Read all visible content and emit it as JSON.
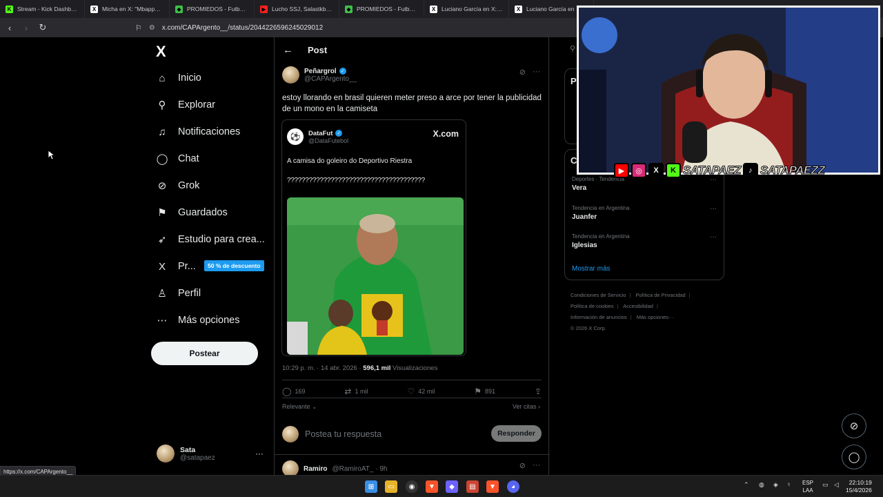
{
  "browser": {
    "tabs": [
      {
        "label": "Stream - Kick Dashboard",
        "color": "#53fc18",
        "glyph": "K"
      },
      {
        "label": "Micha en X: \"Mbappe co",
        "color": "#ffffff",
        "glyph": "X"
      },
      {
        "label": "PROMIEDOS - Futbol Arg",
        "color": "#3fbf4a",
        "glyph": "◆"
      },
      {
        "label": "Lucho SSJ, Salastkbron -",
        "color": "#ff2020",
        "glyph": "▶"
      },
      {
        "label": "PROMIEDOS - Futbol Arg",
        "color": "#3fbf4a",
        "glyph": "◆"
      },
      {
        "label": "Luciano García en X: \"Se x",
        "color": "#ffffff",
        "glyph": "X"
      },
      {
        "label": "Luciano García en",
        "color": "#ffffff",
        "glyph": "X"
      }
    ],
    "url": "x.com/CAPArgento__/status/2044226596245029012",
    "status_url": "https://x.com/CAPArgento__"
  },
  "nav": {
    "logo": "X",
    "items": [
      {
        "label": "Inicio",
        "icon": "home-icon",
        "glyph": "⌂"
      },
      {
        "label": "Explorar",
        "icon": "search-icon",
        "glyph": "⚲"
      },
      {
        "label": "Notificaciones",
        "icon": "bell-icon",
        "glyph": "♫"
      },
      {
        "label": "Chat",
        "icon": "chat-icon",
        "glyph": "◯"
      },
      {
        "label": "Grok",
        "icon": "grok-icon",
        "glyph": "⊘"
      },
      {
        "label": "Guardados",
        "icon": "bookmark-icon",
        "glyph": "⚑"
      },
      {
        "label": "Estudio para crea...",
        "icon": "rocket-icon",
        "glyph": "➶"
      },
      {
        "label": "Pr...",
        "icon": "premium-x-icon",
        "glyph": "X"
      },
      {
        "label": "Perfil",
        "icon": "profile-icon",
        "glyph": "♙"
      },
      {
        "label": "Más opciones",
        "icon": "more-options-icon",
        "glyph": "⋯"
      }
    ],
    "promo_badge": "50 % de descuento",
    "post_button": "Postear",
    "me": {
      "name": "Sata",
      "handle": "@satapaez",
      "more": "···"
    }
  },
  "main": {
    "back": "←",
    "title": "Post",
    "post": {
      "author_name": "Peñargrol",
      "author_handle": "@CAPArgento__",
      "text": "estoy llorando en brasil quieren meter preso a arce por tener la publicidad de un mono en la camiseta",
      "quote": {
        "name": "DataFut",
        "handle": "@DataFutebol",
        "brand": "X.com",
        "text1": "A camisa do goleiro do Deportivo Riestra",
        "text2": "??????????????????????????????????????"
      },
      "time": "10:29 p. m. · 14 abr. 2026 ·",
      "views_count": "596,1 mil",
      "views_label": "Visualizaciones",
      "replies": "169",
      "reposts": "1 mil",
      "likes": "42 mil",
      "bookmarks": "891"
    },
    "sort_label": "Relevante",
    "see_quotes": "Ver citas",
    "reply_placeholder": "Postea tu respuesta",
    "reply_button": "Responder",
    "next_reply": {
      "name": "Ramiro",
      "handle": "@RamiroAT_ · 9h"
    }
  },
  "right": {
    "card1_fragment": "P",
    "card2_fragment": "C",
    "trends": [
      {
        "category": "Deportes · Tendencia",
        "title": "Vera"
      },
      {
        "category": "Tendencia en Argentina",
        "title": "Juanfer"
      },
      {
        "category": "Tendencia en Argentina",
        "title": "Iglesias"
      }
    ],
    "show_more": "Mostrar más",
    "footer": {
      "terms": "Condiciones de Servicio",
      "privacy": "Política de Privacidad",
      "cookies": "Política de cookies",
      "accessibility": "Accesibilidad",
      "ads": "Información de anuncios",
      "more": "Más opciones···",
      "copyright": "© 2026 X Corp."
    }
  },
  "overlay": {
    "social_name1": "SATAPAEZ",
    "social_name2": "SATAPAEZZ"
  },
  "taskbar": {
    "lang1": "ESP",
    "lang2": "LAA",
    "time": "22:10:19",
    "date": "15/4/2026"
  }
}
